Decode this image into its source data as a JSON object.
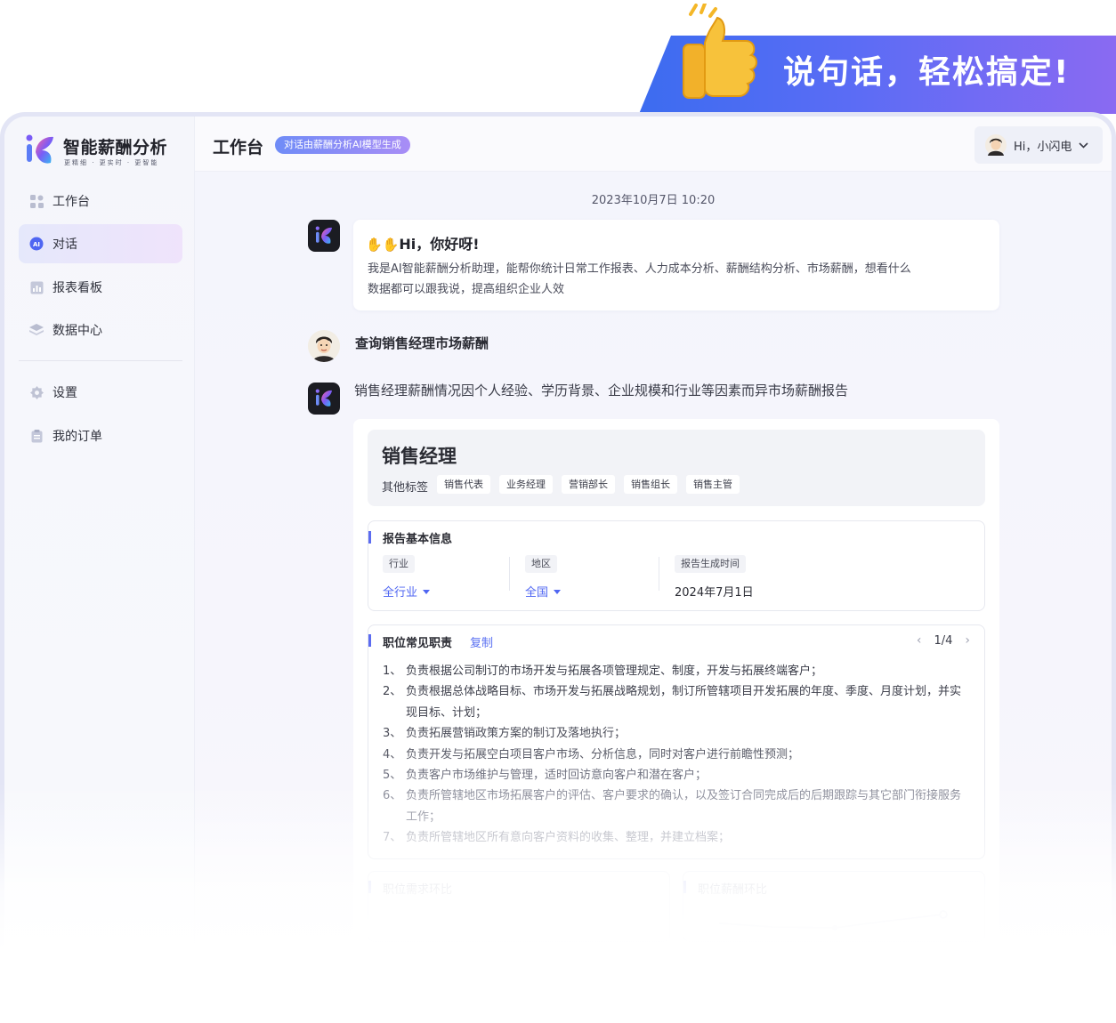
{
  "promo": {
    "text": "说句话，轻松搞定!"
  },
  "brand": {
    "title": "智能薪酬分析",
    "subtitle": "更精细 · 更实时 · 更智能"
  },
  "sidebar": {
    "items": [
      {
        "label": "工作台",
        "icon": "grid-icon"
      },
      {
        "label": "对话",
        "icon": "ai-chat-icon",
        "active": true
      },
      {
        "label": "报表看板",
        "icon": "chart-icon"
      },
      {
        "label": "数据中心",
        "icon": "layers-icon"
      },
      {
        "label": "设置",
        "icon": "gear-icon"
      },
      {
        "label": "我的订单",
        "icon": "clipboard-icon"
      }
    ]
  },
  "header": {
    "title": "工作台",
    "badge": "对话由薪酬分析AI模型生成",
    "user": "Hi，小闪电"
  },
  "chat": {
    "timestamp": "2023年10月7日 10:20",
    "greeting_title": "Hi，你好呀!",
    "greeting_text": "我是AI智能薪酬分析助理，能帮你统计日常工作报表、人力成本分析、薪酬结构分析、市场薪酬，想看什么数据都可以跟我说，提高组织企业人效",
    "user_message": "查询销售经理市场薪酬",
    "bot_reply": "销售经理薪酬情况因个人经验、学历背景、企业规模和行业等因素而异市场薪酬报告"
  },
  "report": {
    "role": "销售经理",
    "tags_label": "其他标签",
    "tags": [
      "销售代表",
      "业务经理",
      "营销部长",
      "销售组长",
      "销售主管"
    ],
    "basic_info": {
      "title": "报告基本信息",
      "fields": [
        {
          "label": "行业",
          "value": "全行业"
        },
        {
          "label": "地区",
          "value": "全国"
        },
        {
          "label": "报告生成时间",
          "value": "2024年7月1日"
        }
      ]
    },
    "duties": {
      "title": "职位常见职责",
      "copy": "复制",
      "page": "1/4",
      "items": [
        "负责根据公司制订的市场开发与拓展各项管理规定、制度，开发与拓展终端客户；",
        "负责根据总体战略目标、市场开发与拓展战略规划，制订所管辖项目开发拓展的年度、季度、月度计划，并实现目标、计划；",
        "负责拓展营销政策方案的制订及落地执行；",
        "负责开发与拓展空白项目客户市场、分析信息，同时对客户进行前瞻性预测；",
        "负责客户市场维护与管理，适时回访意向客户和潜在客户；",
        "负责所管辖地区市场拓展客户的评估、客户要求的确认，以及签订合同完成后的后期跟踪与其它部门衔接服务工作；",
        "负责所管辖地区所有意向客户资料的收集、整理，并建立档案；"
      ]
    },
    "demand_title": "职位需求环比",
    "salary_title": "职位薪酬环比"
  },
  "colors": {
    "accent": "#5c6cf0",
    "link": "#4f66f2",
    "banner_start": "#3c6cf0",
    "banner_end": "#8a6af2"
  }
}
